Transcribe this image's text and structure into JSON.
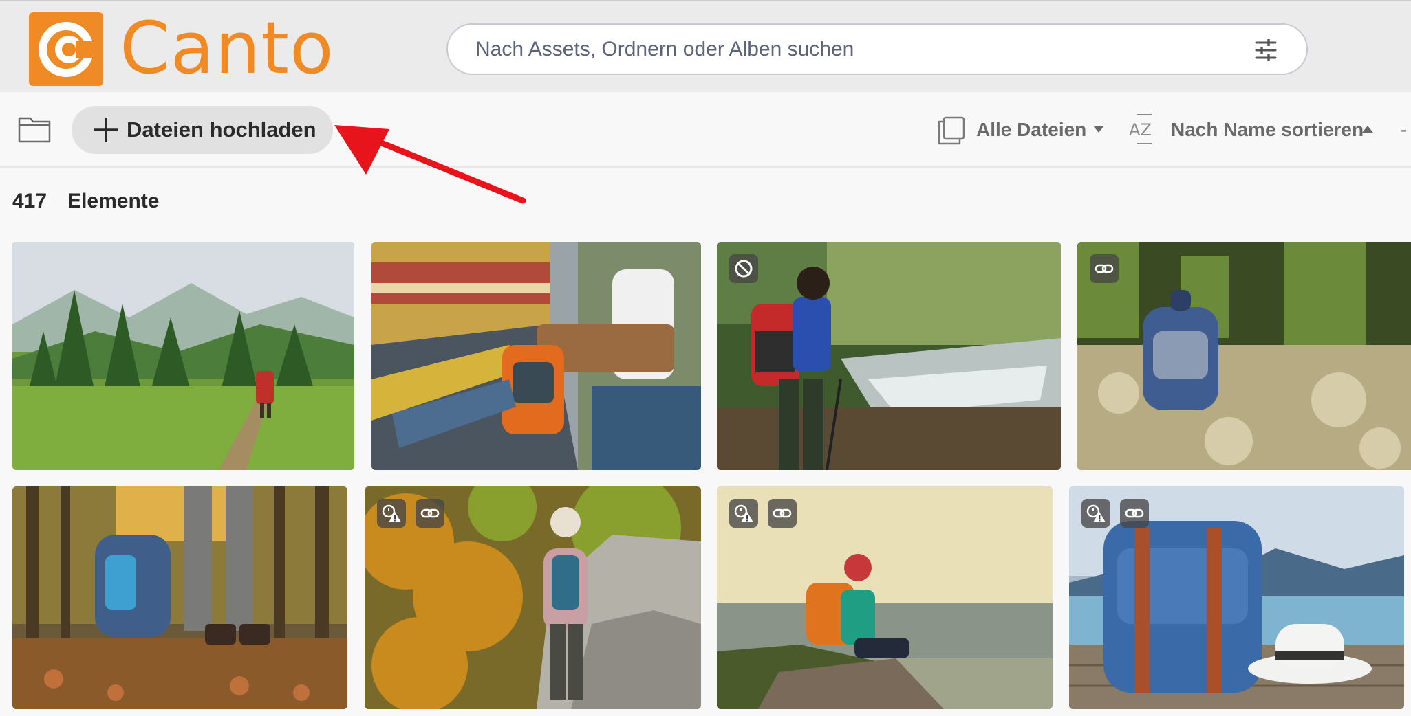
{
  "header": {
    "logo_text": "Canto",
    "search_placeholder": "Nach Assets, Ordnern oder Alben suchen"
  },
  "toolbar": {
    "upload_label": "Dateien hochladen",
    "filter_label": "Alle Dateien",
    "sort_label": "Nach Name sortieren",
    "sort_icon_text": "AZ"
  },
  "summary": {
    "count": "417",
    "unit": "Elemente"
  },
  "icons": {
    "folder": "folder-icon",
    "upload": "plus-icon",
    "filter": "files-icon",
    "sort": "sort-az-icon",
    "search_filter": "sliders-icon",
    "restricted": "restricted-icon",
    "expired": "expiry-warning-icon",
    "link": "link-icon"
  },
  "colors": {
    "brand": "#f08a24",
    "header_bg": "#ebebeb",
    "toolbar_bg": "#f8f8f8",
    "upload_button_bg": "#e1e1e1",
    "annotation_arrow": "#e8141c"
  },
  "gallery": {
    "tiles": [
      {
        "subject": "hiker in green mountain meadow",
        "badges": []
      },
      {
        "subject": "traveler with orange backpack at train station",
        "badges": []
      },
      {
        "subject": "hiker with trekking poles by forest stream",
        "badges": [
          "restricted"
        ]
      },
      {
        "subject": "blue backpack on mossy ground",
        "badges": [
          "link"
        ]
      },
      {
        "subject": "backpack and hiking boots on autumn forest path",
        "badges": []
      },
      {
        "subject": "woman hiker on rocks among autumn trees",
        "badges": [
          "expired",
          "link"
        ]
      },
      {
        "subject": "hiker with orange backpack sitting on cliff at sunset",
        "badges": [
          "expired",
          "link"
        ]
      },
      {
        "subject": "blue backpack and white hat on pier by lake",
        "badges": [
          "expired",
          "link"
        ]
      }
    ]
  }
}
